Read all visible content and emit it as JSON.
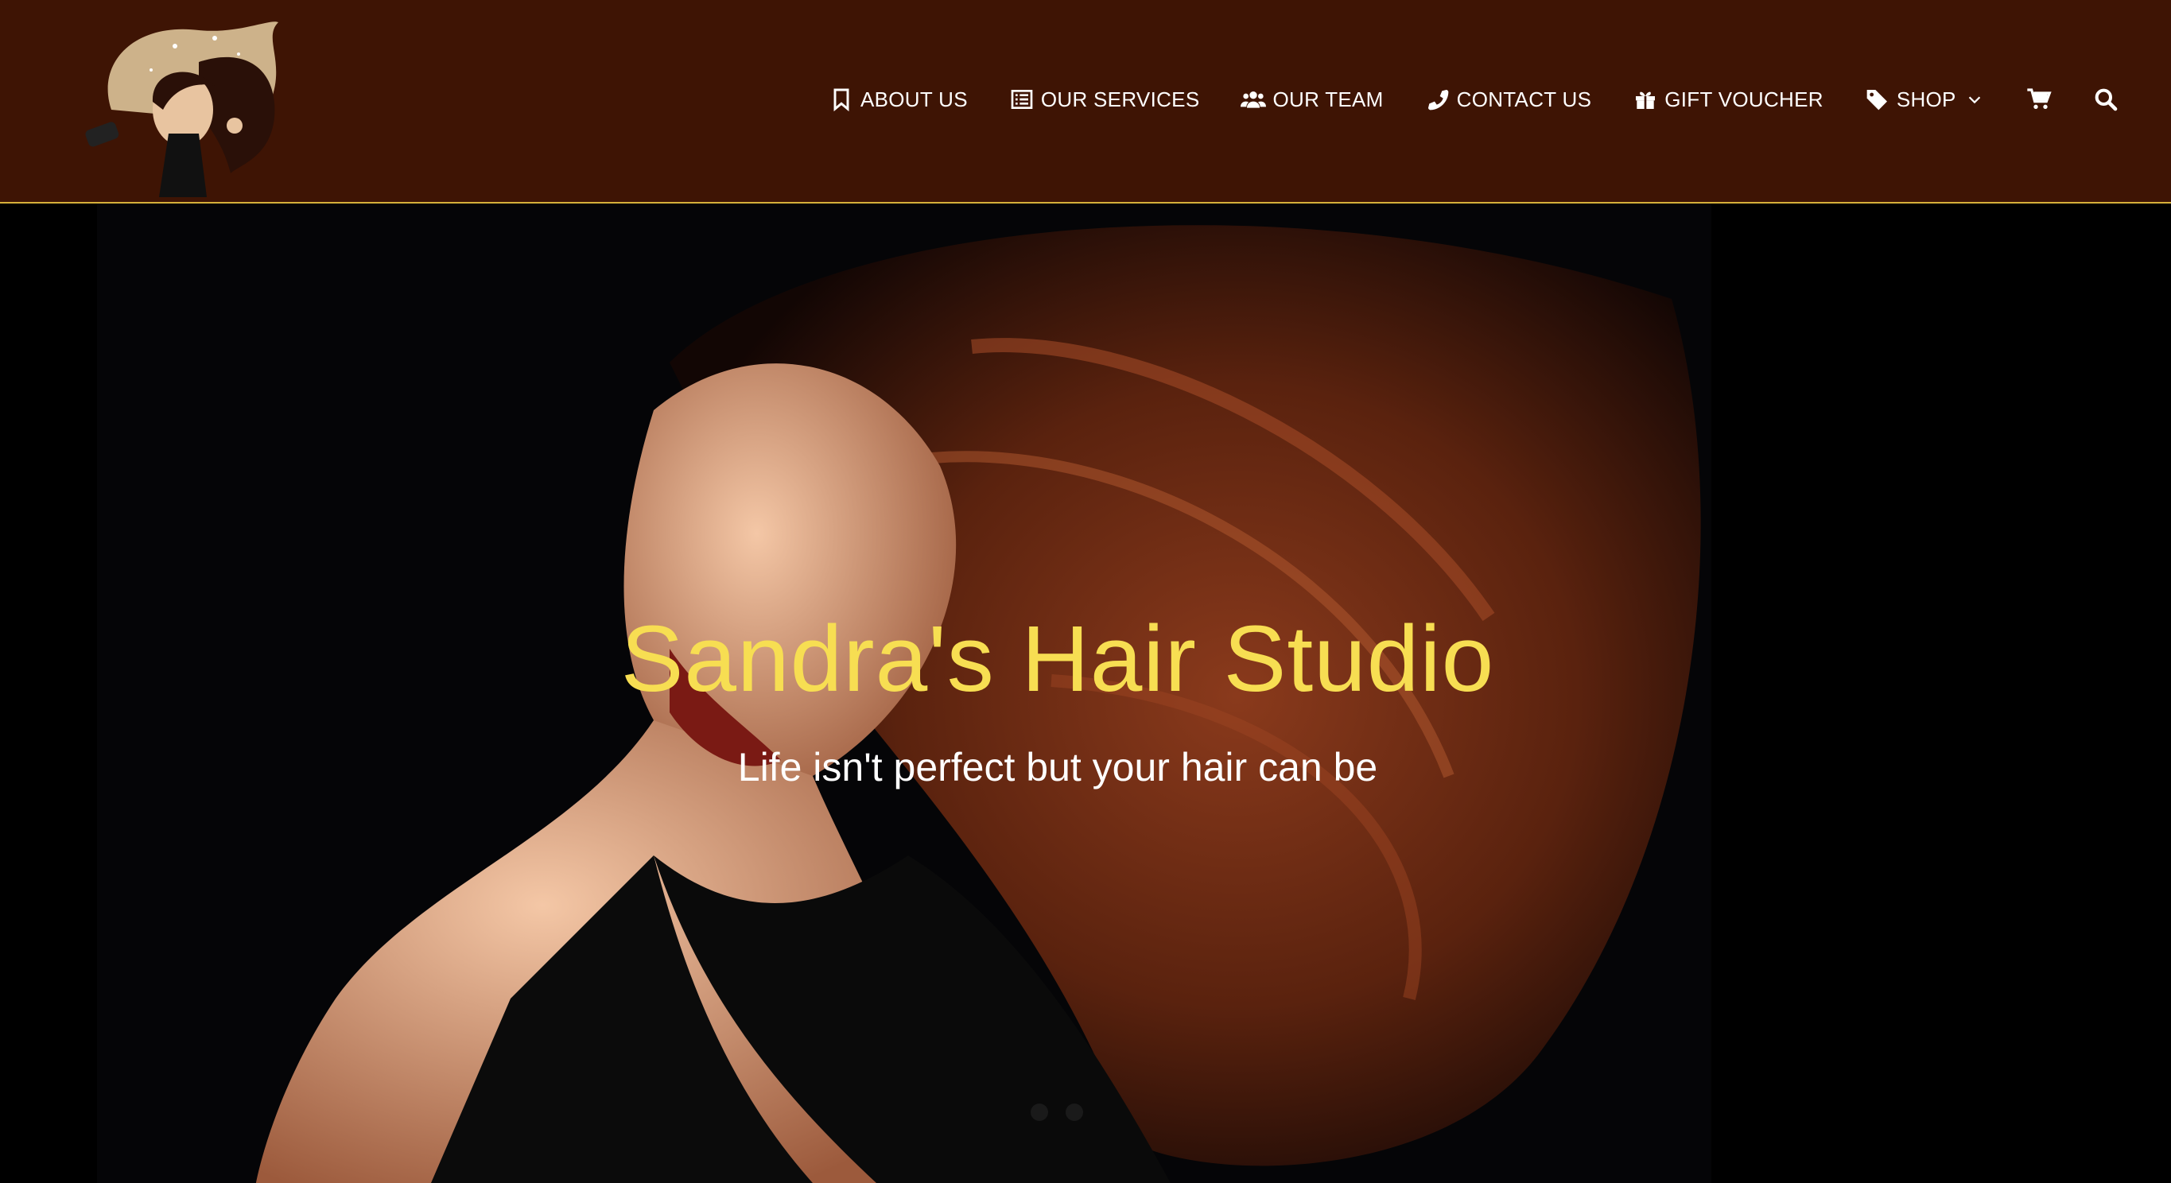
{
  "colors": {
    "header_bg": "#3e1404",
    "header_border": "#d6b03a",
    "hero_title": "#f7de52",
    "nav_text": "#ffffff"
  },
  "nav": {
    "items": [
      {
        "label": "ABOUT US",
        "icon": "bookmark-icon"
      },
      {
        "label": "OUR SERVICES",
        "icon": "list-icon"
      },
      {
        "label": "OUR TEAM",
        "icon": "users-icon"
      },
      {
        "label": "CONTACT US",
        "icon": "phone-icon"
      },
      {
        "label": "GIFT VOUCHER",
        "icon": "gift-icon"
      },
      {
        "label": "SHOP",
        "icon": "tags-icon"
      }
    ],
    "cart_icon": "cart-icon",
    "search_icon": "search-icon"
  },
  "hero": {
    "title": "Sandra's Hair Studio",
    "subtitle": "Life isn't perfect but your hair can be",
    "slide_count": 2
  }
}
